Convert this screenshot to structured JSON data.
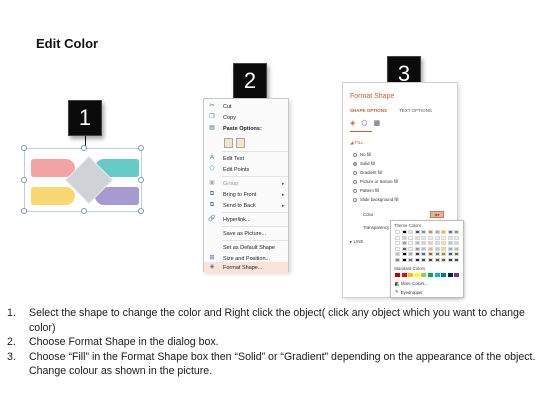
{
  "title": "Edit Color",
  "steps": {
    "one": "1",
    "two": "2",
    "three": "3"
  },
  "diagram": {
    "colors": {
      "pink": "#f3a3a3",
      "teal": "#66cbc6",
      "yellow": "#f9d874",
      "purple": "#a79ad0",
      "diamond": "#cfd3d8"
    }
  },
  "context_menu": {
    "items": [
      {
        "label": "Cut",
        "icon": "cut-icon"
      },
      {
        "label": "Copy",
        "icon": "copy-icon"
      },
      {
        "label": "Paste Options:",
        "icon": "paste-icon"
      },
      {
        "label": "Edit Text",
        "icon": "edit-text-icon"
      },
      {
        "label": "Edit Points",
        "icon": "edit-points-icon"
      },
      {
        "label": "Group",
        "icon": "group-icon"
      },
      {
        "label": "Bring to Front",
        "icon": "bring-front-icon"
      },
      {
        "label": "Send to Back",
        "icon": "send-back-icon"
      },
      {
        "label": "Hyperlink...",
        "icon": "hyperlink-icon"
      },
      {
        "label": "Save as Picture...",
        "icon": ""
      },
      {
        "label": "Set as Default Shape",
        "icon": ""
      },
      {
        "label": "Size and Position...",
        "icon": "size-position-icon"
      },
      {
        "label": "Format Shape...",
        "icon": "format-shape-icon"
      }
    ]
  },
  "format_panel": {
    "title": "Format Shape",
    "tabs": {
      "shape_options": "SHAPE OPTIONS",
      "text_options": "TEXT OPTIONS"
    },
    "fill_section": "FILL",
    "fill_options": [
      "No fill",
      "Solid fill",
      "Gradient fill",
      "Picture or texture fill",
      "Pattern fill",
      "Slide background fill"
    ],
    "selected_fill": "Solid fill",
    "color_label": "Color",
    "transparency_label": "Transparency",
    "line_section": "LINE",
    "accent_color": "#d65a31"
  },
  "palette": {
    "theme_label": "Theme Colors",
    "standard_label": "Standard Colors",
    "more_colors": "More Colors...",
    "eyedropper": "Eyedropper",
    "theme_top_row": [
      "#ffffff",
      "#000000",
      "#e7e6e6",
      "#44546a",
      "#5b9bd5",
      "#ed7d31",
      "#a5a5a5",
      "#ffc000",
      "#4472c4",
      "#70ad47"
    ],
    "standard_row": [
      "#c00000",
      "#ff0000",
      "#ffc000",
      "#ffff00",
      "#92d050",
      "#00b050",
      "#00b0f0",
      "#0070c0",
      "#002060",
      "#7030a0"
    ]
  },
  "instructions": [
    {
      "num": "1.",
      "text": "Select the shape to change the color and Right click the object( click any object which you want to change color)"
    },
    {
      "num": "2.",
      "text": "Choose Format Shape in the dialog box."
    },
    {
      "num": "3.",
      "text": "Choose “Fill” in the Format Shape box then “Solid” or “Gradient” depending on the appearance of the object. Change colour as shown in the picture."
    }
  ]
}
